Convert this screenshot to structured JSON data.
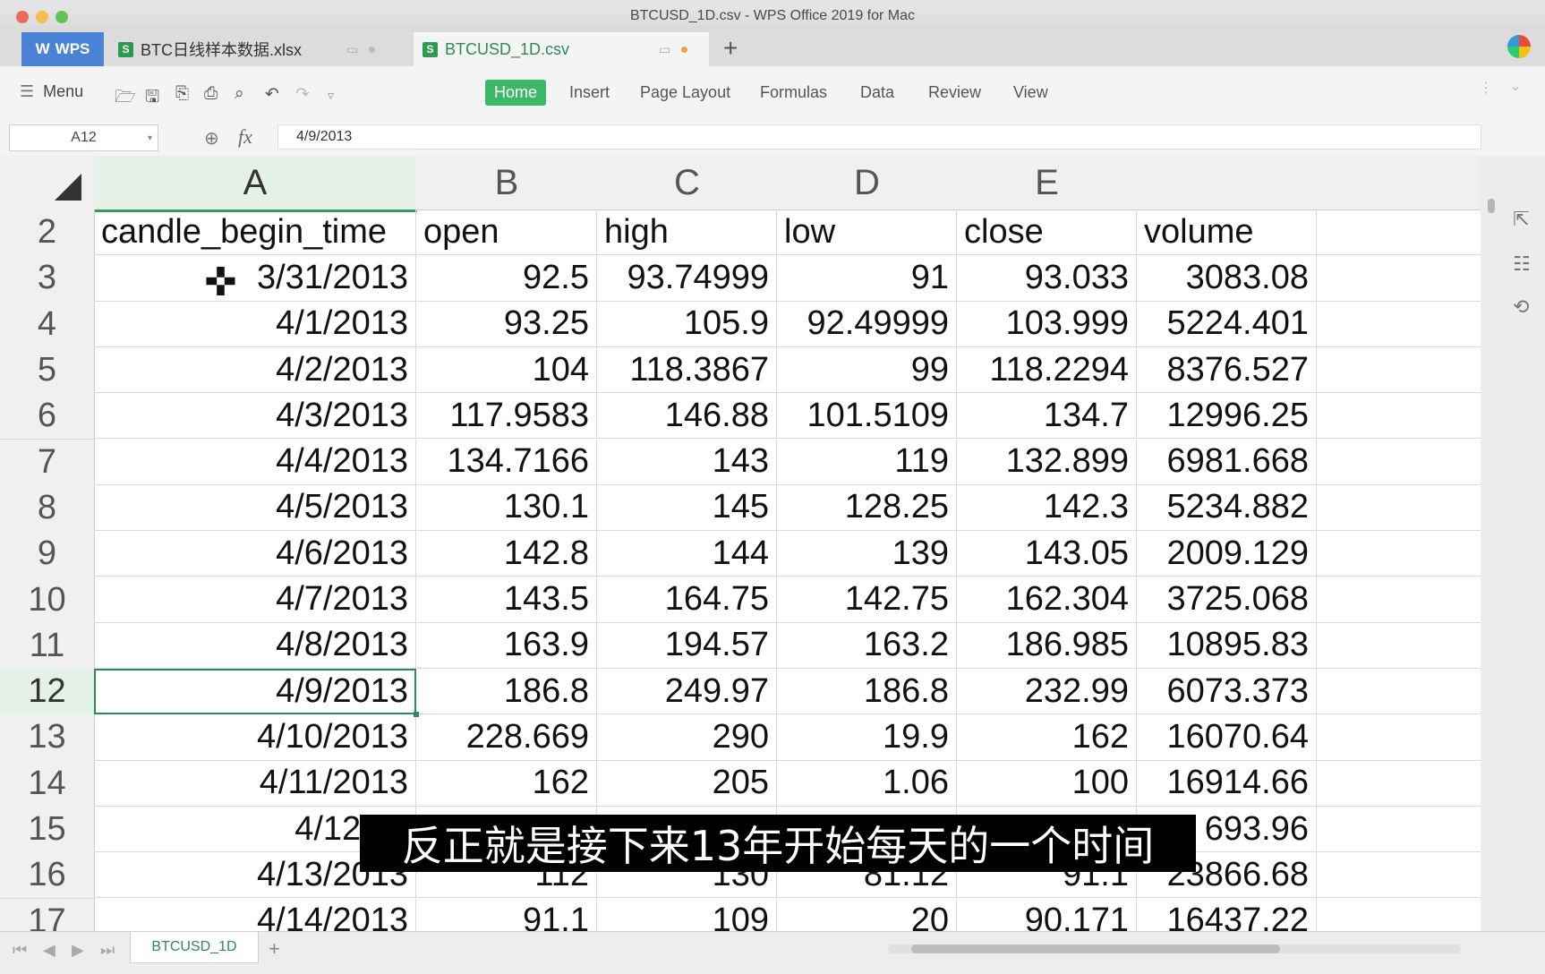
{
  "window": {
    "title": "BTCUSD_1D.csv - WPS Office 2019 for Mac"
  },
  "tabs": {
    "wps_label": "WPS",
    "items": [
      {
        "label": "BTC日线样本数据.xlsx"
      },
      {
        "label": "BTCUSD_1D.csv"
      }
    ],
    "add_label": "+"
  },
  "ribbon": {
    "menu_label": "Menu",
    "tabs": [
      "Home",
      "Insert",
      "Page Layout",
      "Formulas",
      "Data",
      "Review",
      "View"
    ]
  },
  "formula_bar": {
    "name_box": "A12",
    "fx_label": "fx",
    "value": "4/9/2013"
  },
  "sheet": {
    "columns": [
      "A",
      "B",
      "C",
      "D",
      "E"
    ],
    "header_row": {
      "num": "2",
      "cells": [
        "candle_begin_time",
        "open",
        "high",
        "low",
        "close",
        "volume"
      ]
    },
    "rows": [
      {
        "num": "3",
        "cells": [
          "3/31/2013",
          "92.5",
          "93.74999",
          "91",
          "93.033",
          "3083.08"
        ]
      },
      {
        "num": "4",
        "cells": [
          "4/1/2013",
          "93.25",
          "105.9",
          "92.49999",
          "103.999",
          "5224.401"
        ]
      },
      {
        "num": "5",
        "cells": [
          "4/2/2013",
          "104",
          "118.3867",
          "99",
          "118.2294",
          "8376.527"
        ]
      },
      {
        "num": "6",
        "cells": [
          "4/3/2013",
          "117.9583",
          "146.88",
          "101.5109",
          "134.7",
          "12996.25"
        ]
      },
      {
        "num": "7",
        "cells": [
          "4/4/2013",
          "134.7166",
          "143",
          "119",
          "132.899",
          "6981.668"
        ]
      },
      {
        "num": "8",
        "cells": [
          "4/5/2013",
          "130.1",
          "145",
          "128.25",
          "142.3",
          "5234.882"
        ]
      },
      {
        "num": "9",
        "cells": [
          "4/6/2013",
          "142.8",
          "144",
          "139",
          "143.05",
          "2009.129"
        ]
      },
      {
        "num": "10",
        "cells": [
          "4/7/2013",
          "143.5",
          "164.75",
          "142.75",
          "162.304",
          "3725.068"
        ]
      },
      {
        "num": "11",
        "cells": [
          "4/8/2013",
          "163.9",
          "194.57",
          "163.2",
          "186.985",
          "10895.83"
        ]
      },
      {
        "num": "12",
        "cells": [
          "4/9/2013",
          "186.8",
          "249.97",
          "186.8",
          "232.99",
          "6073.373"
        ]
      },
      {
        "num": "13",
        "cells": [
          "4/10/2013",
          "228.669",
          "290",
          "19.9",
          "162",
          "16070.64"
        ]
      },
      {
        "num": "14",
        "cells": [
          "4/11/2013",
          "162",
          "205",
          "1.06",
          "100",
          "16914.66"
        ]
      },
      {
        "num": "15",
        "cells": [
          "4/12/20",
          "",
          "",
          "",
          "",
          "693.96"
        ]
      },
      {
        "num": "16",
        "cells": [
          "4/13/2013",
          "112",
          "130",
          "81.12",
          "91.1",
          "23866.68"
        ]
      },
      {
        "num": "17",
        "cells": [
          "4/14/2013",
          "91.1",
          "109",
          "20",
          "90.171",
          "16437.22"
        ]
      }
    ],
    "selected_cell": "A12"
  },
  "sheet_tabs": {
    "active": "BTCUSD_1D",
    "add_label": "+"
  },
  "subtitle": "反正就是接下来13年开始每天的一个时间",
  "colors": {
    "accent": "#3db869",
    "selection": "#2e8b57",
    "wps_tab": "#4a82d6"
  }
}
